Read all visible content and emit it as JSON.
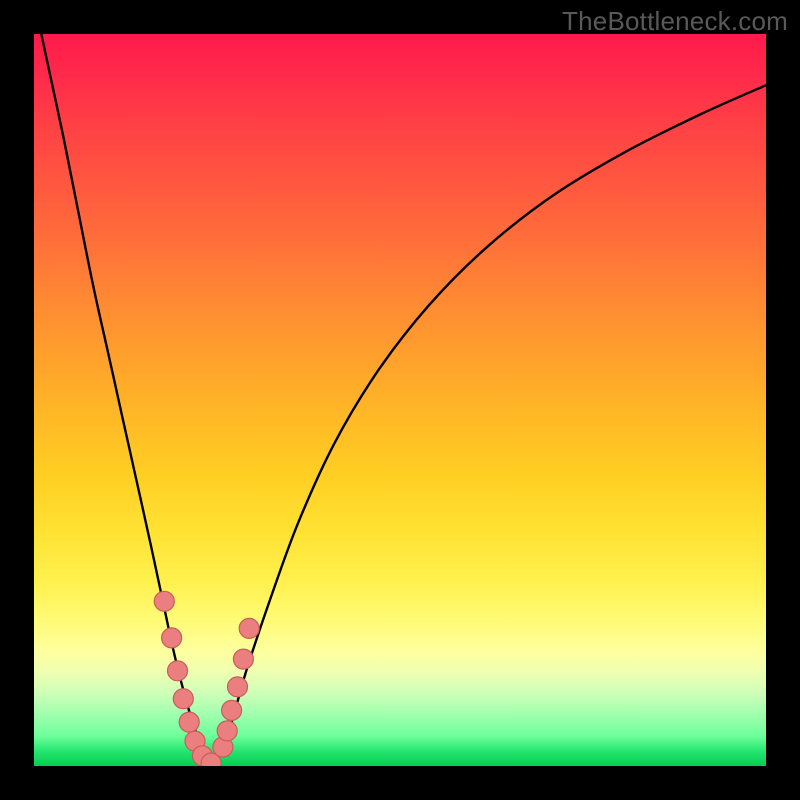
{
  "watermark": "TheBottleneck.com",
  "colors": {
    "frame": "#000000",
    "curve": "#000000",
    "marker_fill": "#eb7e7e",
    "marker_stroke": "#c95c5c"
  },
  "chart_data": {
    "type": "line",
    "title": "",
    "xlabel": "",
    "ylabel": "",
    "xlim": [
      0,
      100
    ],
    "ylim": [
      0,
      100
    ],
    "grid": false,
    "legend": false,
    "series": [
      {
        "name": "bottleneck-curve",
        "x": [
          1,
          2.5,
          4,
          6,
          8,
          10,
          12,
          14,
          16,
          17.5,
          19,
          20.5,
          22,
          23.5,
          24.5,
          25.5,
          27,
          29,
          32,
          36,
          41,
          47,
          54,
          62,
          71,
          81,
          91,
          100
        ],
        "y": [
          100,
          93,
          86,
          76,
          66,
          57,
          48,
          39,
          30,
          23,
          16,
          10,
          5,
          2,
          0.5,
          2,
          6,
          13,
          22,
          33,
          44,
          54,
          63,
          71,
          78,
          84,
          89,
          93
        ]
      }
    ],
    "markers": {
      "name": "highlighted-points",
      "x": [
        17.8,
        18.8,
        19.6,
        20.4,
        21.2,
        22.0,
        23.0,
        24.2,
        25.8,
        26.4,
        27.0,
        27.8,
        28.6,
        29.4
      ],
      "y": [
        22.5,
        17.5,
        13.0,
        9.2,
        6.0,
        3.4,
        1.4,
        0.4,
        2.6,
        4.8,
        7.6,
        10.8,
        14.6,
        18.8
      ],
      "radius": 10
    }
  }
}
